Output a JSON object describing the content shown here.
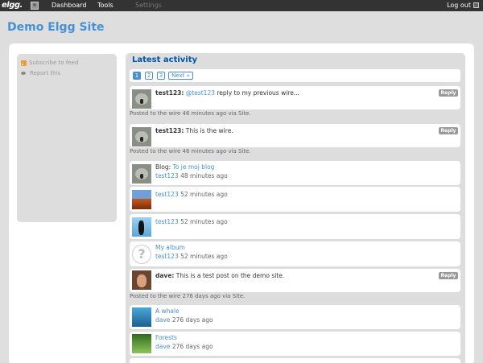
{
  "topbar": {
    "logo": "elgg.",
    "nav": [
      "Dashboard",
      "Tools",
      "Settings"
    ],
    "logout": "Log out"
  },
  "site_title": "Demo Elgg Site",
  "sidebar": {
    "links": [
      "Subscribe to feed",
      "Report this"
    ]
  },
  "main": {
    "title": "Latest activity",
    "pager": {
      "pages": [
        "1",
        "2",
        "3"
      ],
      "next": "Next »",
      "current": "1"
    },
    "reply_label": "Reply",
    "items": [
      {
        "author": "test123:",
        "mention": "@test123",
        "text": " reply to my previous wire...",
        "posted": "Posted to the wire 46 minutes ago via Site."
      },
      {
        "author": "test123:",
        "text": " This is the wire.",
        "posted": "Posted to the wire 46 minutes ago via Site."
      },
      {
        "prefix": "Blog:",
        "title": "To je moj blog",
        "user": "test123",
        "time": "48 minutes ago"
      },
      {
        "user": "test123",
        "time": "52 minutes ago"
      },
      {
        "user": "test123",
        "time": "52 minutes ago"
      },
      {
        "title": "My album",
        "user": "test123",
        "time": "52 minutes ago"
      },
      {
        "author": "dave:",
        "text": " This is a test post on the demo site.",
        "posted": "Posted to the wire 276 days ago via Site."
      },
      {
        "title": "A whale",
        "user": "dave",
        "time": "276 days ago"
      },
      {
        "title": "Forests",
        "user": "dave",
        "time": "276 days ago"
      }
    ]
  }
}
